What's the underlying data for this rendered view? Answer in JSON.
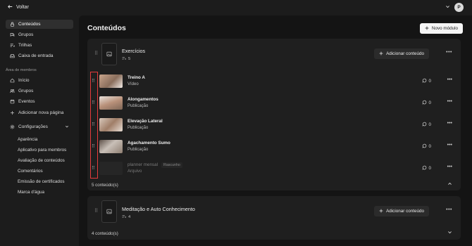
{
  "topbar": {
    "back_label": "Voltar",
    "avatar_letter": "P"
  },
  "sidebar": {
    "items": [
      {
        "label": "Conteúdos",
        "icon": "lock-icon"
      },
      {
        "label": "Grupos",
        "icon": "chat-icon"
      },
      {
        "label": "Trilhas",
        "icon": "list-icon"
      },
      {
        "label": "Caixa de entrada",
        "icon": "inbox-icon"
      }
    ],
    "section_label": "Área de membros",
    "member_items": [
      {
        "label": "Início",
        "icon": "home-icon"
      },
      {
        "label": "Grupos",
        "icon": "users-icon"
      },
      {
        "label": "Eventos",
        "icon": "calendar-icon"
      },
      {
        "label": "Adicionar nova página",
        "icon": "plus-icon"
      }
    ],
    "settings_label": "Configurações",
    "settings_items": [
      "Aparência",
      "Aplicativo para membros",
      "Avaliação de conteúdos",
      "Comentários",
      "Emissão de certificados",
      "Marca d'água"
    ]
  },
  "main": {
    "title": "Conteúdos",
    "new_module_label": "Novo módulo",
    "add_content_label": "Adicionar conteúdo",
    "modules": [
      {
        "title": "Exercícios",
        "count": "5",
        "footer": "5 conteúdo(s)",
        "rows": [
          {
            "title": "Treino A",
            "type": "Vídeo",
            "comments": "0"
          },
          {
            "title": "Alongamentos",
            "type": "Publicação",
            "comments": "0"
          },
          {
            "title": "Elevação Lateral",
            "type": "Publicação",
            "comments": "0"
          },
          {
            "title": "Agachamento Sumo",
            "type": "Publicação",
            "comments": "0"
          },
          {
            "title": "planner mensal",
            "type": "Arquivo",
            "badge": "Rascunho",
            "comments": "0"
          }
        ]
      },
      {
        "title": "Meditação e Auto Conhecimento",
        "count": "4",
        "footer": "4 conteúdo(s)"
      }
    ]
  },
  "colors": {
    "highlight": "#e53b3b",
    "background": "#141414",
    "card": "#1f1f1f"
  }
}
